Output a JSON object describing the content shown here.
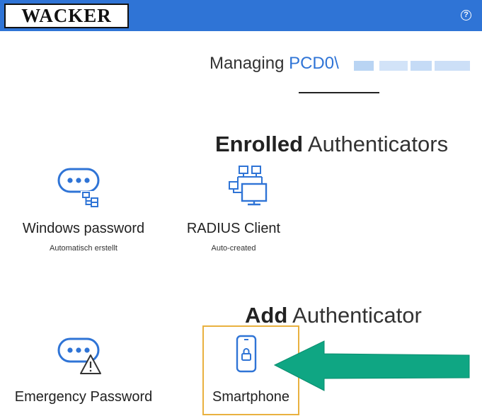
{
  "header": {
    "logo_text": "WACKER",
    "help_glyph": "?",
    "bar_color": "#2f74d6"
  },
  "managing": {
    "prefix": "Managing",
    "account": "PCD0\\"
  },
  "enrolled": {
    "title_bold": "Enrolled",
    "title_rest": " Authenticators",
    "items": [
      {
        "label": "Windows password",
        "sub": "Automatisch erstellt",
        "icon": "windows-password-icon"
      },
      {
        "label": "RADIUS Client",
        "sub": "Auto-created",
        "icon": "radius-client-icon"
      }
    ]
  },
  "add": {
    "title_bold": "Add",
    "title_rest": " Authenticator",
    "items": [
      {
        "label": "Emergency Password",
        "icon": "emergency-password-icon"
      },
      {
        "label": "Smartphone",
        "icon": "smartphone-icon",
        "highlighted": true
      }
    ]
  },
  "colors": {
    "accent": "#2f74d6",
    "highlight_border": "#e9b13f",
    "arrow": "#0fa683"
  }
}
